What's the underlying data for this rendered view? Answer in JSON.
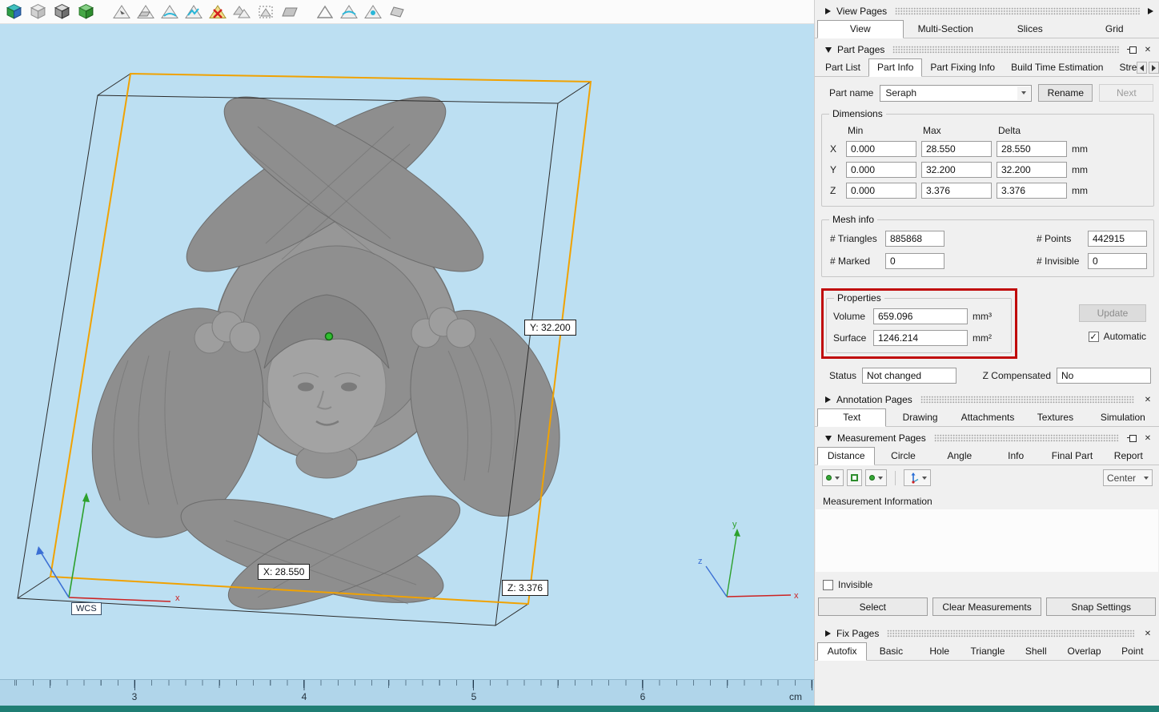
{
  "toolbar": {
    "icons": [
      "view-cube-icon",
      "cube-wire-icon",
      "cube-section-icon",
      "cube-solid-green-icon",
      "mark-triangle-icon",
      "mark-plane-icon",
      "mark-surface-icon",
      "mark-connected-icon",
      "unmark-all-icon",
      "mark-shell-icon",
      "mark-window-icon",
      "plane-solid-icon",
      "new-triangle-icon",
      "triangle-edge-icon",
      "triangle-point-icon",
      "plane-flag-icon"
    ]
  },
  "viewport": {
    "dim_labels": {
      "y": "Y: 32.200",
      "x": "X: 28.550",
      "z": "Z: 3.376"
    },
    "wcs_label": "WCS",
    "axis_labels": {
      "x": "x",
      "y": "y",
      "z": "z"
    },
    "ruler": {
      "ticks": [
        "3",
        "4",
        "5",
        "6"
      ],
      "unit": "cm"
    }
  },
  "view_pages": {
    "title": "View Pages",
    "tabs": [
      "View",
      "Multi-Section",
      "Slices",
      "Grid"
    ]
  },
  "part_pages": {
    "title": "Part Pages",
    "tabs": [
      "Part List",
      "Part Info",
      "Part Fixing Info",
      "Build Time Estimation",
      "Stre"
    ],
    "part_name_label": "Part name",
    "part_name_value": "Seraph",
    "rename_button": "Rename",
    "next_button": "Next",
    "dimensions": {
      "title": "Dimensions",
      "col_min": "Min",
      "col_max": "Max",
      "col_delta": "Delta",
      "unit": "mm",
      "x": {
        "axis": "X",
        "min": "0.000",
        "max": "28.550",
        "delta": "28.550"
      },
      "y": {
        "axis": "Y",
        "min": "0.000",
        "max": "32.200",
        "delta": "32.200"
      },
      "z": {
        "axis": "Z",
        "min": "0.000",
        "max": "3.376",
        "delta": "3.376"
      }
    },
    "mesh_info": {
      "title": "Mesh info",
      "triangles_label": "# Triangles",
      "triangles_value": "885868",
      "points_label": "# Points",
      "points_value": "442915",
      "marked_label": "# Marked",
      "marked_value": "0",
      "invisible_label": "# Invisible",
      "invisible_value": "0"
    },
    "properties": {
      "title": "Properties",
      "volume_label": "Volume",
      "volume_value": "659.096",
      "volume_unit": "mm³",
      "surface_label": "Surface",
      "surface_value": "1246.214",
      "surface_unit": "mm²",
      "update_button": "Update",
      "automatic_label": "Automatic"
    },
    "status_label": "Status",
    "status_value": "Not changed",
    "z_compensated_label": "Z Compensated",
    "z_compensated_value": "No"
  },
  "annotation_pages": {
    "title": "Annotation Pages",
    "tabs": [
      "Text",
      "Drawing",
      "Attachments",
      "Textures",
      "Simulation"
    ]
  },
  "measurement_pages": {
    "title": "Measurement Pages",
    "tabs": [
      "Distance",
      "Circle",
      "Angle",
      "Info",
      "Final Part",
      "Report"
    ],
    "center_combo": "Center",
    "info_label": "Measurement Information",
    "invisible_label": "Invisible",
    "select_button": "Select",
    "clear_button": "Clear Measurements",
    "snap_button": "Snap Settings"
  },
  "fix_pages": {
    "title": "Fix Pages",
    "tabs": [
      "Autofix",
      "Basic",
      "Hole",
      "Triangle",
      "Shell",
      "Overlap",
      "Point"
    ]
  },
  "colors": {
    "viewport_blue": "#bcdff2",
    "bbox_orange": "#f0a202",
    "highlight_red": "#c00a0a",
    "statusbar_teal": "#1f7e74",
    "model_gray": "#8e8e8e"
  }
}
